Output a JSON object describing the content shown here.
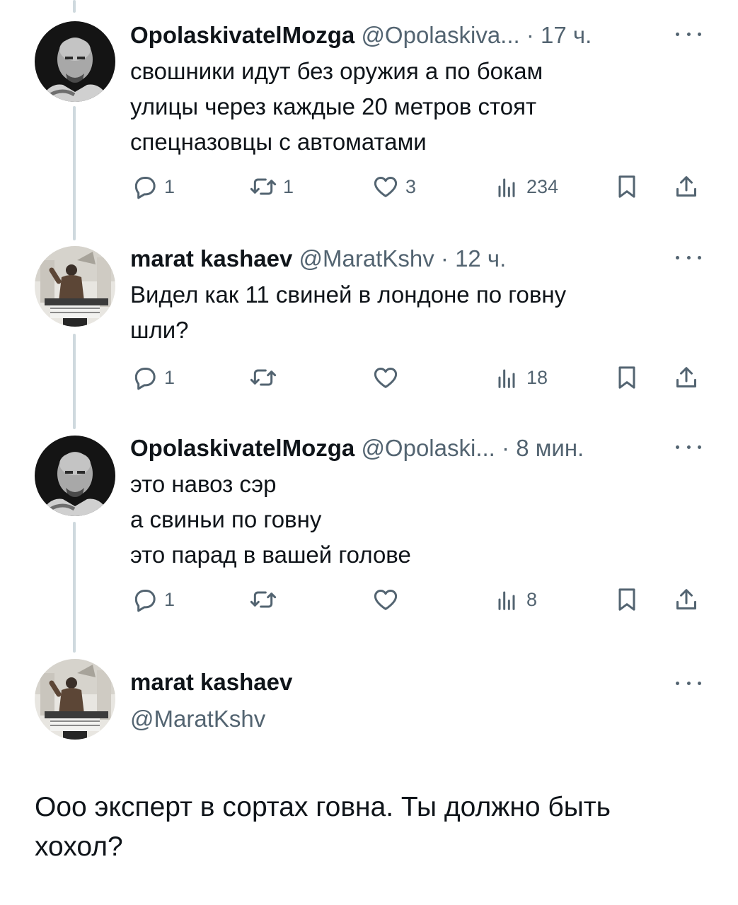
{
  "tweets": [
    {
      "name": "OpolaskivatelMozga",
      "handle": "@Opolaskiva...",
      "dot": "·",
      "time": "17 ч.",
      "lines": [
        "свошники идут без оружия а по бокам",
        "улицы через каждые 20 метров стоят",
        "спецназовцы с автоматами"
      ],
      "replies": "1",
      "retweets": "1",
      "likes": "3",
      "views": "234",
      "avatar": "bald-man-avatar"
    },
    {
      "name": "marat kashaev",
      "handle": "@MaratKshv",
      "dot": "·",
      "time": "12 ч.",
      "lines": [
        "Видел как 11 свиней в лондоне по говну",
        "шли?"
      ],
      "replies": "1",
      "retweets": "",
      "likes": "",
      "views": "18",
      "avatar": "man-at-desk-avatar"
    },
    {
      "name": "OpolaskivatelMozga",
      "handle": "@Opolaski...",
      "dot": "·",
      "time": "8 мин.",
      "lines": [
        "это навоз сэр",
        "а свиньи по говну",
        "это парад в вашей голове"
      ],
      "replies": "1",
      "retweets": "",
      "likes": "",
      "views": "8",
      "avatar": "bald-man-avatar"
    }
  ],
  "main_tweet": {
    "name": "marat kashaev",
    "handle": "@MaratKshv",
    "lines": [
      "Ооо эксперт в сортах говна. Ты должно быть",
      "хохол?"
    ],
    "avatar": "man-at-desk-avatar"
  },
  "icons": {
    "reply": "reply-icon",
    "retweet": "retweet-icon",
    "like": "heart-icon",
    "views": "views-icon",
    "bookmark": "bookmark-icon",
    "share": "share-icon",
    "more": "more-icon"
  },
  "colors": {
    "text": "#0f1419",
    "secondary": "#536471",
    "thread_line": "#cfd9de"
  }
}
